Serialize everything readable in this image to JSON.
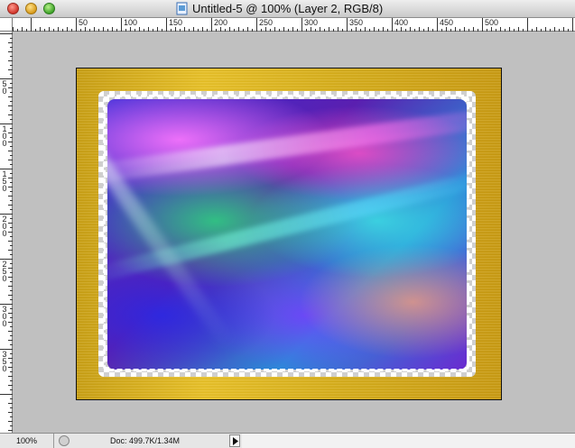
{
  "window": {
    "title": "Untitled-5 @ 100% (Layer 2, RGB/8)"
  },
  "rulers": {
    "horizontal_ticks": [
      "50",
      "100",
      "150",
      "200",
      "250",
      "300",
      "350",
      "400",
      "450",
      "500"
    ],
    "vertical_ticks": [
      "5\n0",
      "1\n0\n0",
      "1\n5\n0",
      "2\n0\n0",
      "2\n5\n0",
      "3\n0\n0",
      "3\n5\n0"
    ]
  },
  "statusbar": {
    "zoom": "100%",
    "doc_info": "Doc: 499.7K/1.34M"
  },
  "icons": {
    "document": "photoshop-document-icon",
    "status": "status-circle-icon",
    "menu": "triangle-right-icon"
  }
}
